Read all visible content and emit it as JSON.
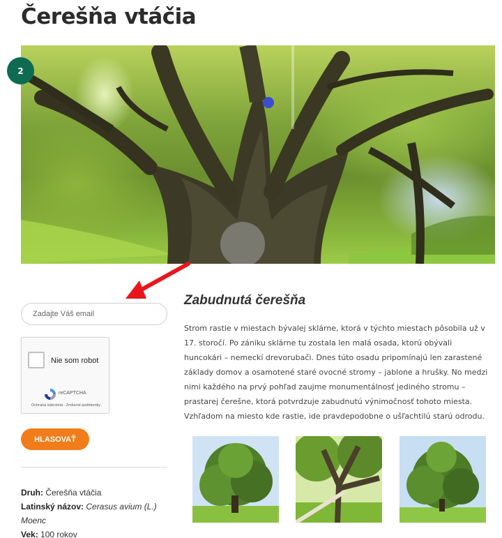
{
  "page": {
    "title": "Čerešňa vtáčia",
    "step_number": "2"
  },
  "form": {
    "email_placeholder": "Zadajte Váš email",
    "recaptcha": {
      "label": "Nie som robot",
      "brand": "reCAPTCHA",
      "legal": "Ochrana súkromia - Zmluvné podmienky"
    },
    "vote_label": "HLASOVAŤ"
  },
  "info": {
    "druh_label": "Druh:",
    "druh_value": "Čerešňa vtáčia",
    "latin_label": "Latinský názov:",
    "latin_value": "Cerasus avium (L.) Moenc",
    "vek_label": "Vek:",
    "vek_value": "100 rokov"
  },
  "article": {
    "heading": "Zabudnutá čerešňa",
    "body": "Strom rastie v miestach bývalej sklárne, ktorá v týchto miestach pôsobila už v 17. storočí. Po zániku sklárne tu zostala len malá osada, ktorú obývali huncokári – nemeckí drevorubači. Dnes túto osadu pripomínajú len zarastené základy domov a osamotené staré ovocné stromy – jablone a hrušky. No medzi nimi každého na prvý pohľad zaujme monumentálnosť jediného stromu –  prastarej čerešne, ktorá potvrdzuje zabudnutú výnimočnosť tohoto miesta. Vzhľadom na miesto kde rastie, ide pravdepodobne o ušľachtilú starú odrodu."
  },
  "colors": {
    "badge": "#0e6b52",
    "vote_button": "#f07d1a",
    "arrow": "#e8161b"
  },
  "icons": {
    "arrow": "red-arrow-annotation",
    "recaptcha": "recaptcha-logo-icon"
  }
}
